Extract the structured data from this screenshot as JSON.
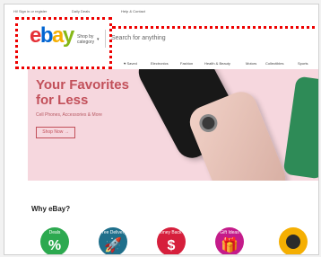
{
  "topbar": {
    "sign_in": "Hi! Sign in or register",
    "daily_deals": "Daily Deals",
    "help": "Help & Contact"
  },
  "header": {
    "logo_letters": [
      "e",
      "b",
      "a",
      "y"
    ],
    "shop_by_line1": "Shop by",
    "shop_by_line2": "category",
    "search_placeholder": "Search for anything",
    "highlight_color": "#e00000"
  },
  "nav": {
    "items": [
      "♥ Saved",
      "Electronics",
      "Fashion",
      "Health & Beauty",
      "Motors",
      "Collectibles",
      "Sports"
    ]
  },
  "banner": {
    "headline_line1": "Your Favorites",
    "headline_line2": "for Less",
    "subline": "Cell Phones, Accessories & More",
    "cta": "Shop Now →"
  },
  "why": {
    "title": "Why eBay?",
    "tiles": [
      {
        "caption": "Deals",
        "glyph": "%",
        "color": "#2ca94f",
        "icon": "percent-icon"
      },
      {
        "caption": "Free Delivery",
        "glyph": "🚀",
        "color": "#1f6f8b",
        "icon": "rocket-icon"
      },
      {
        "caption": "Money Back Guarantee",
        "glyph": "$",
        "color": "#d61f3c",
        "icon": "dollar-icon"
      },
      {
        "caption": "Gift Ideas",
        "glyph": "🎁",
        "color": "#c41b8a",
        "icon": "gift-icon"
      }
    ]
  }
}
